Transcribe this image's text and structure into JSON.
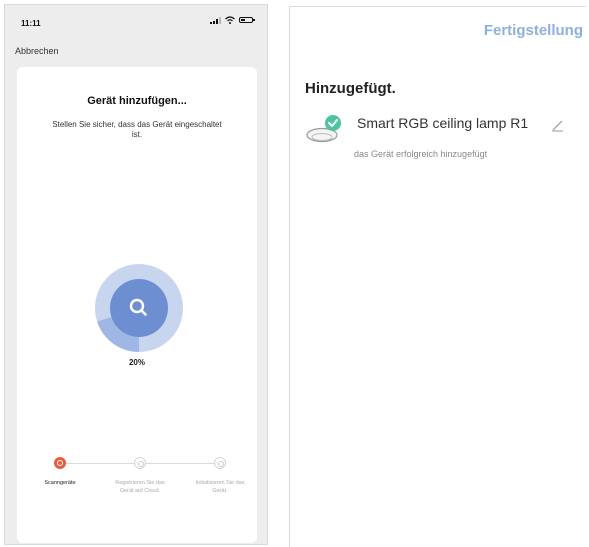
{
  "left_screen": {
    "status_bar": {
      "time": "11:11"
    },
    "cancel_label": "Abbrechen",
    "title": "Gerät hinzufügen...",
    "subtitle": "Stellen Sie sicher, dass das Gerät eingeschaltet ist.",
    "progress": {
      "percent": 20,
      "label": "20%"
    },
    "steps": [
      {
        "label": "Scanngeräte",
        "active": true
      },
      {
        "label": "Registrieren Sie das Gerät auf Cloud.",
        "active": false
      },
      {
        "label": "Initialisieren Sie das Gerät.",
        "active": false
      }
    ],
    "colors": {
      "accent": "#ec5a3c",
      "ring": "#6d8fd1"
    }
  },
  "right_screen": {
    "done_label": "Fertigstellung",
    "title": "Hinzugefügt.",
    "device": {
      "name": "Smart RGB ceiling lamp R1",
      "status": "das Gerät erfolgreich hinzugefügt",
      "icon": "ceiling-lamp-icon",
      "badge_icon": "check-icon"
    },
    "colors": {
      "done": "#8fb0dd",
      "check": "#4fc3a1"
    }
  }
}
